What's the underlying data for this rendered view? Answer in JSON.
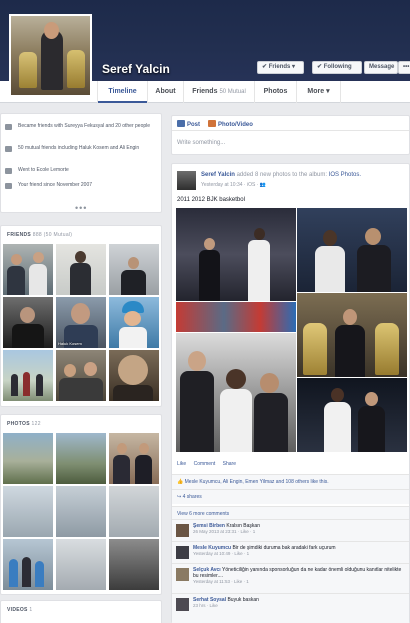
{
  "profile": {
    "name": "Seref Yalcin"
  },
  "cover_buttons": {
    "friends": "Friends ▾",
    "following": "Following",
    "message": "Message",
    "more": "•••"
  },
  "nav": {
    "timeline": "Timeline",
    "about": "About",
    "friends": "Friends",
    "friends_count": "50 Mutual",
    "photos": "Photos",
    "more": "More ▾"
  },
  "about": {
    "items": [
      "Became friends with Sureyya Fekusyal and 20 other people",
      "50 mutual friends including Haluk Kosem and Ali Engin",
      "Went to Ecole Lemorte",
      "Your friend since November 2007"
    ],
    "more": "•••"
  },
  "friends_box": {
    "title": "FRIENDS",
    "count": "888 (50 Mutual)",
    "names": [
      "",
      "",
      "",
      "",
      "Haluk Kosem",
      "",
      "",
      "",
      ""
    ]
  },
  "photos_box": {
    "title": "PHOTOS",
    "count": "122"
  },
  "videos_box": {
    "title": "VIDEOS",
    "count": "1"
  },
  "composer": {
    "post": "Post",
    "photo_video": "Photo/Video",
    "placeholder": "Write something..."
  },
  "story": {
    "author": "Seref Yalcin",
    "action": " added 8 new photos to the album: ",
    "album": "IOS Photos.",
    "time": "Yesterday at 10:34 · iOS · ",
    "album_title": "2011 2012 BJK basketbol",
    "actions": [
      "Like",
      "Comment",
      "Share"
    ],
    "likes": "Mesle Kuyumcu, Ali Engin, Emen Yilmaz and 108 others like this.",
    "shares": "4 shares",
    "view_more": "View 6 more comments",
    "comments": [
      {
        "name": "Şemsi Birben",
        "text": "Kralsın Başkan",
        "meta": "26 May 2013 at 23:31 · Like · 1"
      },
      {
        "name": "Mesle Kuyumcu",
        "text": "Bir de şimdiki duruma bak aradaki fark uçurum",
        "meta": "Yesterday at 10:49 · Like · 1"
      },
      {
        "name": "Selçuk Avcı",
        "text": "Yöneticiliğin yanında sponsorluğun da ne kadar önemli olduğunu kanıtlar nitelikte bu resimler....",
        "meta": "Yesterday at 11:53 · Like · 1"
      },
      {
        "name": "Serhat Soysal",
        "text": "Buyuk baskan",
        "meta": "23 hrs · Like"
      }
    ]
  }
}
